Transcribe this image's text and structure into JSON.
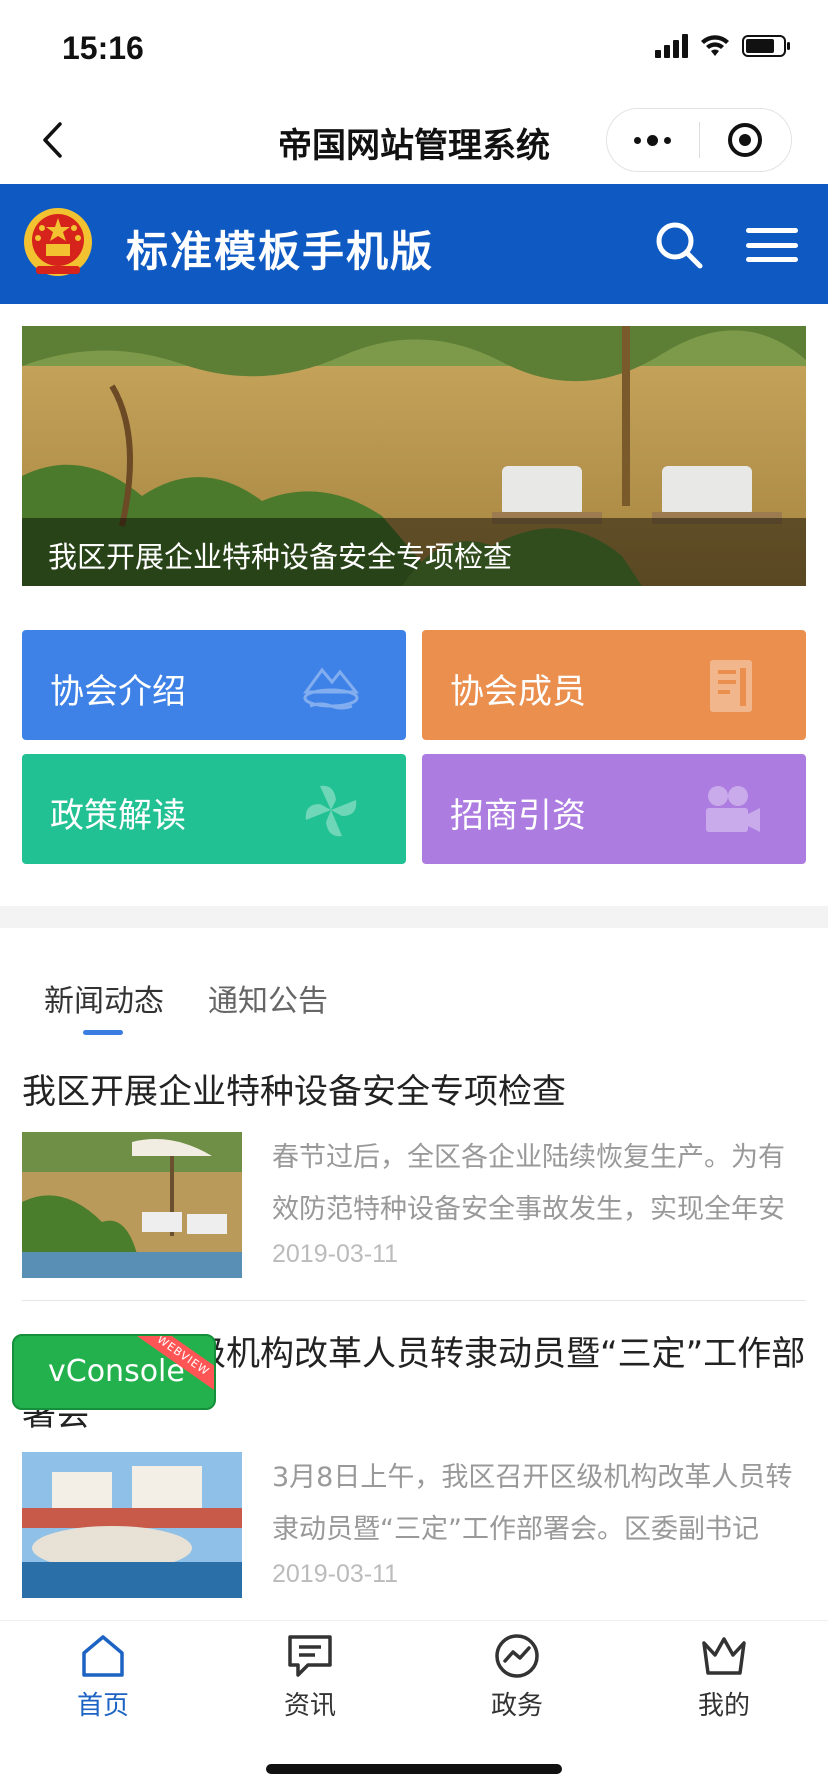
{
  "status_bar": {
    "time": "15:16"
  },
  "nav": {
    "title": "帝国网站管理系统"
  },
  "header": {
    "site_title": "标准模板手机版"
  },
  "banner": {
    "caption": "我区开展企业特种设备安全专项检查"
  },
  "tiles": [
    {
      "label": "协会介绍",
      "color": "#3f82e7",
      "icon": "mountain-icon"
    },
    {
      "label": "协会成员",
      "color": "#ea8f4e",
      "icon": "document-icon"
    },
    {
      "label": "政策解读",
      "color": "#22c193",
      "icon": "pinwheel-icon"
    },
    {
      "label": "招商引资",
      "color": "#ad7ce0",
      "icon": "video-camera-icon"
    }
  ],
  "tabs": [
    {
      "label": "新闻动态",
      "active": true
    },
    {
      "label": "通知公告",
      "active": false
    }
  ],
  "articles": [
    {
      "title": "我区开展企业特种设备安全专项检查",
      "summary": "春节过后，全区各企业陆续恢复生产。为有效防范特种设备安全事故发生，实现全年安",
      "date": "2019-03-11"
    },
    {
      "title": "我区召开区级机构改革人员转隶动员暨“三定”工作部署会",
      "summary": "3月8日上午，我区召开区级机构改革人员转隶动员暨“三定”工作部署会。区委副书记",
      "date": "2019-03-11"
    }
  ],
  "vconsole": {
    "label": "vConsole",
    "ribbon": "WEBVIEW"
  },
  "tab_bar": [
    {
      "label": "首页",
      "icon": "home-icon",
      "active": true
    },
    {
      "label": "资讯",
      "icon": "message-icon",
      "active": false
    },
    {
      "label": "政务",
      "icon": "trend-icon",
      "active": false
    },
    {
      "label": "我的",
      "icon": "crown-icon",
      "active": false
    }
  ],
  "colors": {
    "header_blue": "#0e5ac2",
    "active_blue": "#1d63c3"
  }
}
